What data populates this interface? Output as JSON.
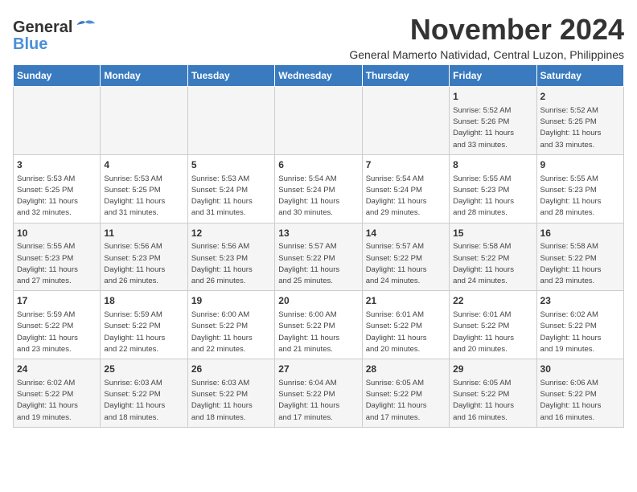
{
  "logo": {
    "line1": "General",
    "line2": "Blue"
  },
  "title": "November 2024",
  "subtitle": "General Mamerto Natividad, Central Luzon, Philippines",
  "days_of_week": [
    "Sunday",
    "Monday",
    "Tuesday",
    "Wednesday",
    "Thursday",
    "Friday",
    "Saturday"
  ],
  "weeks": [
    [
      {
        "day": "",
        "info": ""
      },
      {
        "day": "",
        "info": ""
      },
      {
        "day": "",
        "info": ""
      },
      {
        "day": "",
        "info": ""
      },
      {
        "day": "",
        "info": ""
      },
      {
        "day": "1",
        "info": "Sunrise: 5:52 AM\nSunset: 5:26 PM\nDaylight: 11 hours\nand 33 minutes."
      },
      {
        "day": "2",
        "info": "Sunrise: 5:52 AM\nSunset: 5:25 PM\nDaylight: 11 hours\nand 33 minutes."
      }
    ],
    [
      {
        "day": "3",
        "info": "Sunrise: 5:53 AM\nSunset: 5:25 PM\nDaylight: 11 hours\nand 32 minutes."
      },
      {
        "day": "4",
        "info": "Sunrise: 5:53 AM\nSunset: 5:25 PM\nDaylight: 11 hours\nand 31 minutes."
      },
      {
        "day": "5",
        "info": "Sunrise: 5:53 AM\nSunset: 5:24 PM\nDaylight: 11 hours\nand 31 minutes."
      },
      {
        "day": "6",
        "info": "Sunrise: 5:54 AM\nSunset: 5:24 PM\nDaylight: 11 hours\nand 30 minutes."
      },
      {
        "day": "7",
        "info": "Sunrise: 5:54 AM\nSunset: 5:24 PM\nDaylight: 11 hours\nand 29 minutes."
      },
      {
        "day": "8",
        "info": "Sunrise: 5:55 AM\nSunset: 5:23 PM\nDaylight: 11 hours\nand 28 minutes."
      },
      {
        "day": "9",
        "info": "Sunrise: 5:55 AM\nSunset: 5:23 PM\nDaylight: 11 hours\nand 28 minutes."
      }
    ],
    [
      {
        "day": "10",
        "info": "Sunrise: 5:55 AM\nSunset: 5:23 PM\nDaylight: 11 hours\nand 27 minutes."
      },
      {
        "day": "11",
        "info": "Sunrise: 5:56 AM\nSunset: 5:23 PM\nDaylight: 11 hours\nand 26 minutes."
      },
      {
        "day": "12",
        "info": "Sunrise: 5:56 AM\nSunset: 5:23 PM\nDaylight: 11 hours\nand 26 minutes."
      },
      {
        "day": "13",
        "info": "Sunrise: 5:57 AM\nSunset: 5:22 PM\nDaylight: 11 hours\nand 25 minutes."
      },
      {
        "day": "14",
        "info": "Sunrise: 5:57 AM\nSunset: 5:22 PM\nDaylight: 11 hours\nand 24 minutes."
      },
      {
        "day": "15",
        "info": "Sunrise: 5:58 AM\nSunset: 5:22 PM\nDaylight: 11 hours\nand 24 minutes."
      },
      {
        "day": "16",
        "info": "Sunrise: 5:58 AM\nSunset: 5:22 PM\nDaylight: 11 hours\nand 23 minutes."
      }
    ],
    [
      {
        "day": "17",
        "info": "Sunrise: 5:59 AM\nSunset: 5:22 PM\nDaylight: 11 hours\nand 23 minutes."
      },
      {
        "day": "18",
        "info": "Sunrise: 5:59 AM\nSunset: 5:22 PM\nDaylight: 11 hours\nand 22 minutes."
      },
      {
        "day": "19",
        "info": "Sunrise: 6:00 AM\nSunset: 5:22 PM\nDaylight: 11 hours\nand 22 minutes."
      },
      {
        "day": "20",
        "info": "Sunrise: 6:00 AM\nSunset: 5:22 PM\nDaylight: 11 hours\nand 21 minutes."
      },
      {
        "day": "21",
        "info": "Sunrise: 6:01 AM\nSunset: 5:22 PM\nDaylight: 11 hours\nand 20 minutes."
      },
      {
        "day": "22",
        "info": "Sunrise: 6:01 AM\nSunset: 5:22 PM\nDaylight: 11 hours\nand 20 minutes."
      },
      {
        "day": "23",
        "info": "Sunrise: 6:02 AM\nSunset: 5:22 PM\nDaylight: 11 hours\nand 19 minutes."
      }
    ],
    [
      {
        "day": "24",
        "info": "Sunrise: 6:02 AM\nSunset: 5:22 PM\nDaylight: 11 hours\nand 19 minutes."
      },
      {
        "day": "25",
        "info": "Sunrise: 6:03 AM\nSunset: 5:22 PM\nDaylight: 11 hours\nand 18 minutes."
      },
      {
        "day": "26",
        "info": "Sunrise: 6:03 AM\nSunset: 5:22 PM\nDaylight: 11 hours\nand 18 minutes."
      },
      {
        "day": "27",
        "info": "Sunrise: 6:04 AM\nSunset: 5:22 PM\nDaylight: 11 hours\nand 17 minutes."
      },
      {
        "day": "28",
        "info": "Sunrise: 6:05 AM\nSunset: 5:22 PM\nDaylight: 11 hours\nand 17 minutes."
      },
      {
        "day": "29",
        "info": "Sunrise: 6:05 AM\nSunset: 5:22 PM\nDaylight: 11 hours\nand 16 minutes."
      },
      {
        "day": "30",
        "info": "Sunrise: 6:06 AM\nSunset: 5:22 PM\nDaylight: 11 hours\nand 16 minutes."
      }
    ]
  ]
}
